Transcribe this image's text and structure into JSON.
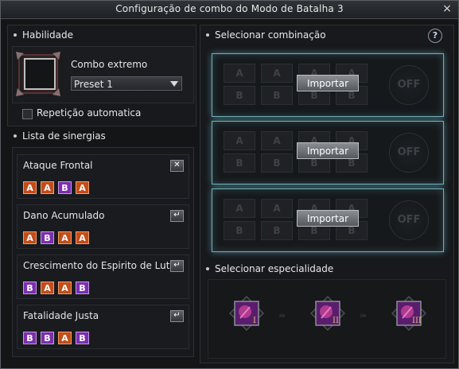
{
  "window": {
    "title": "Configuração de combo do Modo de Batalha 3",
    "close_label": "×"
  },
  "skill": {
    "section_title": "Habilidade",
    "combo_label": "Combo extremo",
    "preset_value": "Preset 1",
    "auto_repeat_label": "Repetição automatica"
  },
  "synergy": {
    "section_title": "Lista de sinergias",
    "items": [
      {
        "name": "Ataque Frontal",
        "button_icon": "close-icon",
        "button_label": "✕",
        "keys": [
          "A",
          "A",
          "B",
          "A"
        ]
      },
      {
        "name": "Dano Acumulado",
        "button_icon": "enter-icon",
        "button_label": "↵",
        "keys": [
          "A",
          "B",
          "A",
          "A"
        ]
      },
      {
        "name": "Crescimento do Espirito de Luta",
        "button_icon": "enter-icon",
        "button_label": "↵",
        "keys": [
          "B",
          "A",
          "A",
          "B"
        ]
      },
      {
        "name": "Fatalidade Justa",
        "button_icon": "enter-icon",
        "button_label": "↵",
        "keys": [
          "B",
          "B",
          "A",
          "B"
        ]
      }
    ]
  },
  "combination": {
    "section_title": "Selecionar combinação",
    "help_label": "?",
    "rows": [
      {
        "slots": [
          "A",
          "A",
          "A",
          "A",
          "B",
          "B",
          "B",
          "B"
        ],
        "import_label": "Importar",
        "toggle_label": "OFF"
      },
      {
        "slots": [
          "A",
          "A",
          "A",
          "A",
          "B",
          "B",
          "B",
          "B"
        ],
        "import_label": "Importar",
        "toggle_label": "OFF"
      },
      {
        "slots": [
          "A",
          "A",
          "A",
          "A",
          "B",
          "B",
          "B",
          "B"
        ],
        "import_label": "Importar",
        "toggle_label": "OFF"
      }
    ]
  },
  "specialty": {
    "section_title": "Selecionar especialidade",
    "items": [
      {
        "numeral": "I"
      },
      {
        "numeral": "II"
      },
      {
        "numeral": "III"
      }
    ],
    "arrow_label": "›››"
  },
  "colors": {
    "key_a": "#c24d1a",
    "key_b": "#7b2fae",
    "combo_glow": "#72aeb8"
  }
}
